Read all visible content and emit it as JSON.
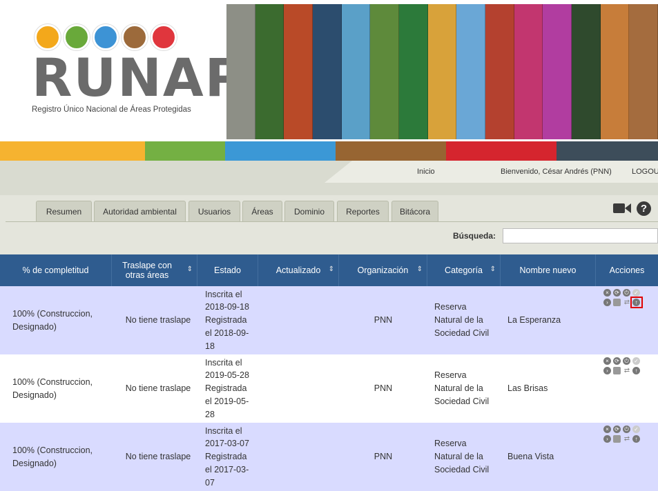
{
  "logo": {
    "wordmark": "RUNAP",
    "subtitle": "Registro Único Nacional de Áreas Protegidas",
    "circle_colors": [
      "#f3a81b",
      "#69a93a",
      "#3d93d5",
      "#9c6a3b",
      "#e0363d"
    ]
  },
  "banner": {
    "strip_colors": [
      "#8d8f86",
      "#3b6b2f",
      "#b94a28",
      "#2c4d6e",
      "#5aa0c8",
      "#5e8a3b",
      "#2c7a3a",
      "#d8a23a",
      "#6aa7d6",
      "#b4412f",
      "#c2366f",
      "#b13da0",
      "#2f4a2d",
      "#c77d3a",
      "#a46c3e"
    ]
  },
  "colorbar": [
    {
      "color": "#f6b330",
      "w": 210
    },
    {
      "color": "#74b043",
      "w": 116
    },
    {
      "color": "#3b98d6",
      "w": 160
    },
    {
      "color": "#976532",
      "w": 160
    },
    {
      "color": "#d5252e",
      "w": 160
    },
    {
      "color": "#3d4d5a",
      "w": 147
    }
  ],
  "topnav": {
    "inicio": "Inicio",
    "welcome": "Bienvenido, César Andrés (PNN)",
    "logout": "LOGOUT"
  },
  "tabs": [
    "Resumen",
    "Autoridad ambiental",
    "Usuarios",
    "Áreas",
    "Dominio",
    "Reportes",
    "Bitácora"
  ],
  "search": {
    "label": "Búsqueda:",
    "value": ""
  },
  "table": {
    "headers": [
      "% de completitud",
      "Traslape con otras áreas",
      "Estado",
      "Actualizado",
      "Organización",
      "Categoría",
      "Nombre nuevo",
      "Acciones"
    ],
    "rows": [
      {
        "completitud": "100% (Construccion, Designado)",
        "traslape": "No tiene traslape",
        "estado": "Inscrita el 2018-09-18 Registrada el 2018-09-18",
        "actualizado": "",
        "organizacion": "PNN",
        "categoria": "Reserva Natural de la Sociedad Civil",
        "nombre": "La Esperanza"
      },
      {
        "completitud": "100% (Construccion, Designado)",
        "traslape": "No tiene traslape",
        "estado": "Inscrita el 2019-05-28 Registrada el 2019-05-28",
        "actualizado": "",
        "organizacion": "PNN",
        "categoria": "Reserva Natural de la Sociedad Civil",
        "nombre": "Las Brisas"
      },
      {
        "completitud": "100% (Construccion, Designado)",
        "traslape": "No tiene traslape",
        "estado": "Inscrita el 2017-03-07 Registrada el 2017-03-07",
        "actualizado": "",
        "organizacion": "PNN",
        "categoria": "Reserva Natural de la Sociedad Civil",
        "nombre": "Buena Vista"
      }
    ]
  }
}
